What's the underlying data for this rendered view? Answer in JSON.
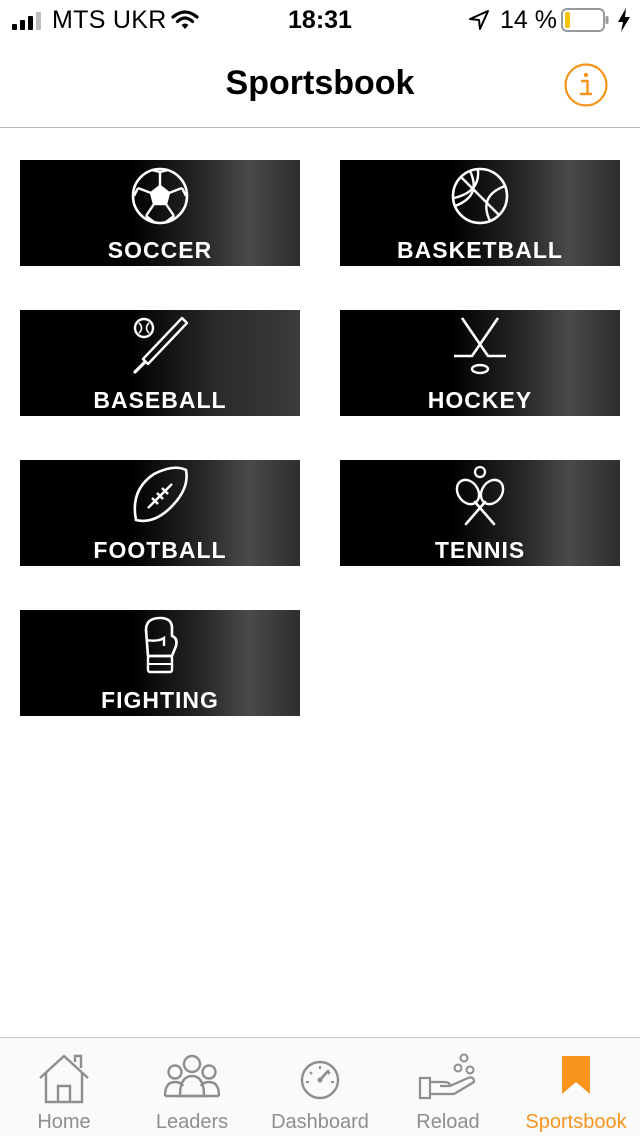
{
  "status_bar": {
    "carrier": "MTS UKR",
    "time": "18:31",
    "battery_percent": "14 %",
    "battery_level": 0.14,
    "signal_bars": 3
  },
  "header": {
    "title": "Sportsbook",
    "info_icon": "info-circle-icon",
    "accent_color": "#f7941d"
  },
  "sports": [
    {
      "label": "SOCCER",
      "icon": "soccer-ball-icon"
    },
    {
      "label": "BASKETBALL",
      "icon": "basketball-icon"
    },
    {
      "label": "BASEBALL",
      "icon": "baseball-bat-icon"
    },
    {
      "label": "HOCKEY",
      "icon": "hockey-sticks-icon"
    },
    {
      "label": "FOOTBALL",
      "icon": "american-football-icon"
    },
    {
      "label": "TENNIS",
      "icon": "tennis-rackets-icon"
    },
    {
      "label": "FIGHTING",
      "icon": "boxing-glove-icon"
    }
  ],
  "tab_bar": {
    "active_color": "#f7941d",
    "inactive_color": "#8e8e8e",
    "tabs": [
      {
        "label": "Home",
        "icon": "home-icon"
      },
      {
        "label": "Leaders",
        "icon": "people-icon"
      },
      {
        "label": "Dashboard",
        "icon": "speedometer-icon"
      },
      {
        "label": "Reload",
        "icon": "hand-coins-icon"
      },
      {
        "label": "Sportsbook",
        "icon": "bookmark-icon",
        "active": true
      }
    ]
  }
}
